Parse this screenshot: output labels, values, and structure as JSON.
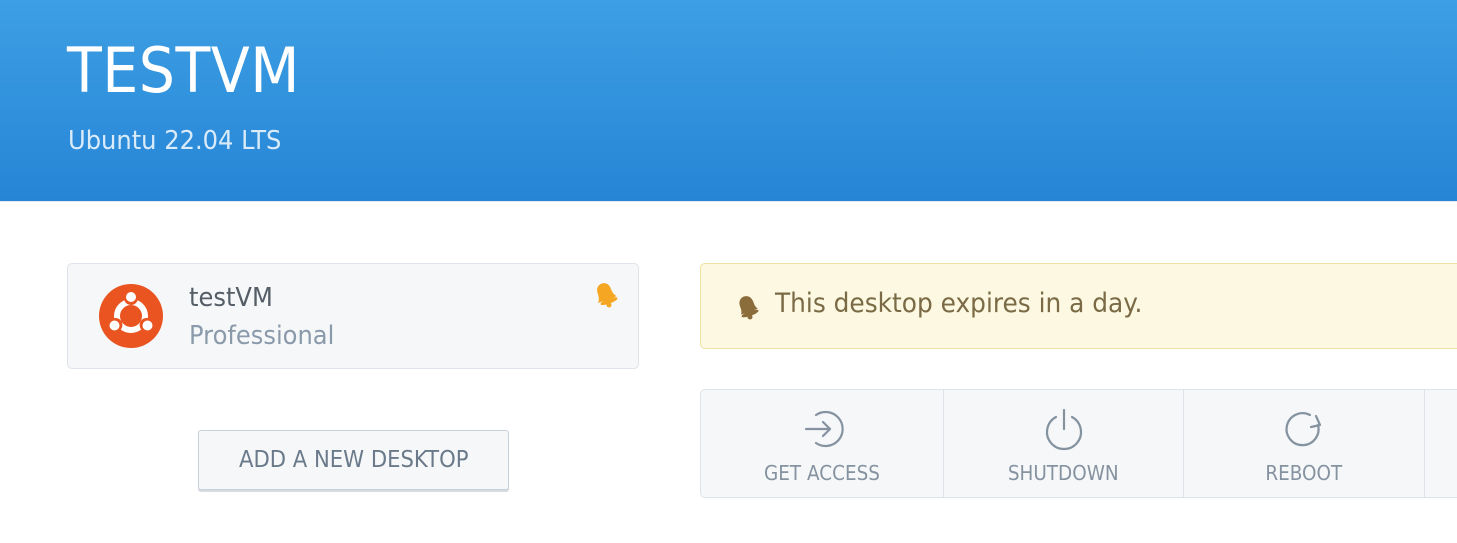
{
  "header": {
    "title": "TESTVM",
    "subtitle": "Ubuntu 22.04 LTS"
  },
  "desktop_card": {
    "name": "testVM",
    "plan": "Professional",
    "logo_icon": "ubuntu-logo-icon",
    "notice_icon": "bell-icon"
  },
  "add_desktop_button": {
    "label": "ADD A NEW DESKTOP"
  },
  "alert": {
    "icon": "bell-icon",
    "text": "This desktop expires in a day."
  },
  "actions": [
    {
      "label": "GET ACCESS",
      "icon": "login-arrow-icon"
    },
    {
      "label": "SHUTDOWN",
      "icon": "power-icon"
    },
    {
      "label": "REBOOT",
      "icon": "reload-icon"
    }
  ],
  "colors": {
    "header_top": "#3d9fe4",
    "header_bottom": "#2685d6",
    "ubuntu_orange": "#e95420",
    "bell_orange": "#f5a623",
    "alert_background": "#fcf8e1"
  }
}
